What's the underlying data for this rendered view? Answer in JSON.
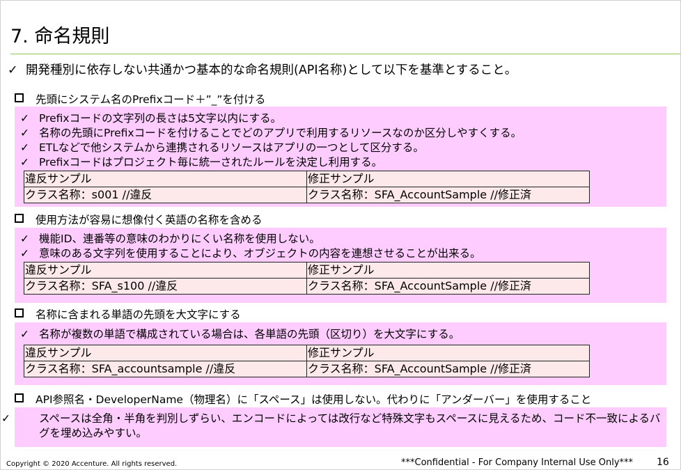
{
  "title": "7. 命名規則",
  "intro": "開発種別に依存しない共通かつ基本的な命名規則(API名称)として以下を基準とすること。",
  "check_glyph": "✓",
  "sections": [
    {
      "heading": "先頭にシステム名のPrefixコード＋”_”を付ける",
      "bullets": [
        "Prefixコードの文字列の長さは5文字以内にする。",
        "名称の先頭にPrefixコードを付けることでどのアプリで利用するリソースなのか区分しやすくする。",
        "ETLなどで他システムから連携されるリソースはアプリの一つとして区分する。",
        "Prefixコードはプロジェクト毎に統一されたルールを決定し利用する。"
      ],
      "table": {
        "bad_header": "違反サンプル",
        "good_header": "修正サンプル",
        "bad_value": "クラス名称：s001  //違反",
        "good_value": "クラス名称：SFA_AccountSample  //修正済"
      }
    },
    {
      "heading": "使用方法が容易に想像付く英語の名称を含める",
      "bullets": [
        "機能ID、連番等の意味のわかりにくい名称を使用しない。",
        "意味のある文字列を使用することにより、オブジェクトの内容を連想させることが出来る。"
      ],
      "table": {
        "bad_header": "違反サンプル",
        "good_header": "修正サンプル",
        "bad_value": "クラス名称：SFA_s100  //違反",
        "good_value": "クラス名称：SFA_AccountSample  //修正済"
      }
    },
    {
      "heading": "名称に含まれる単語の先頭を大文字にする",
      "bullets": [
        "名称が複数の単語で構成されている場合は、各単語の先頭（区切り）を大文字にする。"
      ],
      "table": {
        "bad_header": "違反サンプル",
        "good_header": "修正サンプル",
        "bad_value": "クラス名称：SFA_accountsample //違反",
        "good_value": "クラス名称：SFA_AccountSample //修正済"
      }
    },
    {
      "heading": "API参照名・DeveloperName（物理名）に「スペース」は使用しない。代わりに「アンダーバー」を使用すること",
      "bullets": [
        "スペースは全角・半角を判別しずらい、エンコードによっては改行など特殊文字もスペースに見えるため、コード不一致によるバグを埋め込みやすい。"
      ]
    }
  ],
  "footer": {
    "copyright": "Copyright © 2020 Accenture. All rights reserved.",
    "confidential": "***Confidential - For Company Internal Use Only***",
    "page_number": "16"
  },
  "colors": {
    "panel": "#ffccff",
    "table_bg": "#fde9e9",
    "title_rule": "#92c353"
  }
}
